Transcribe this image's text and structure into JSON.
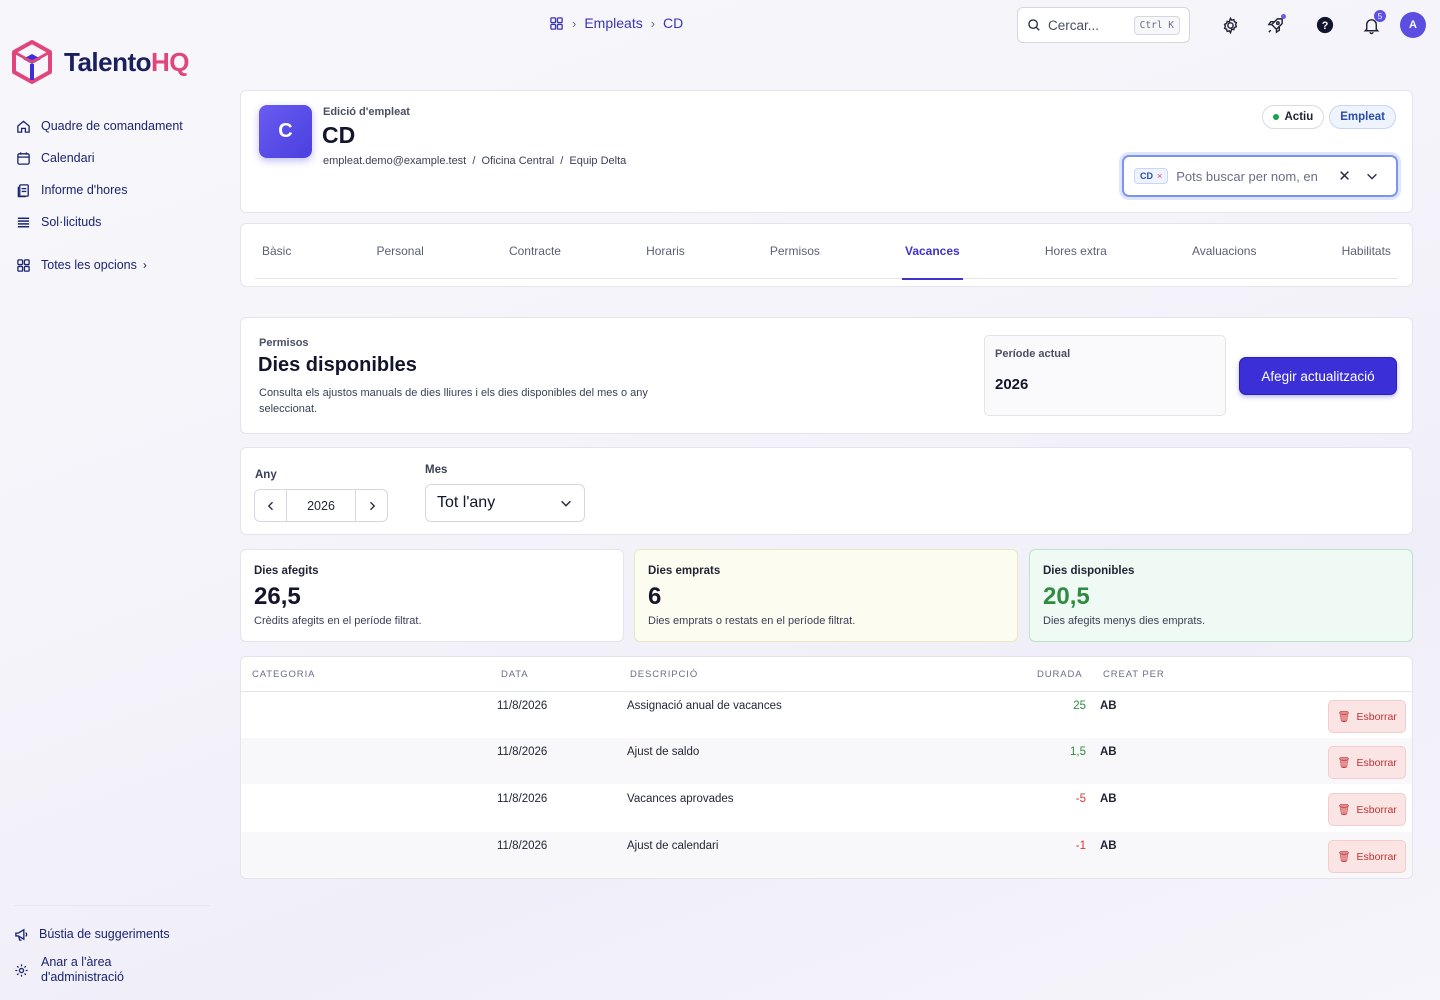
{
  "brand": {
    "name_main": "Talento",
    "name_accent": "HQ"
  },
  "sidebar": {
    "items": [
      {
        "label": "Quadre de comandament",
        "icon": "home-icon"
      },
      {
        "label": "Calendari",
        "icon": "calendar-icon"
      },
      {
        "label": "Informe d'hores",
        "icon": "report-icon"
      },
      {
        "label": "Sol·licituds",
        "icon": "list-icon"
      }
    ],
    "all_options": "Totes les opcions",
    "suggestions": "Bústia de suggeriments",
    "admin_line1": "Anar a l'àrea",
    "admin_line2": "d'administració"
  },
  "topbar": {
    "breadcrumb": [
      "Empleats",
      "CD"
    ],
    "search_placeholder": "Cercar...",
    "search_shortcut": "Ctrl K",
    "notifications_count": "5",
    "user_initial": "A"
  },
  "employee": {
    "subtitle": "Edició d'empleat",
    "initial": "C",
    "name": "CD",
    "email": "empleat.demo@example.test",
    "office": "Oficina Central",
    "team": "Equip Delta",
    "sep": "/",
    "status": "Actiu",
    "role": "Empleat",
    "selected_chip": "CD",
    "select_placeholder": "Pots buscar per nom, en"
  },
  "tabs": [
    "Bàsic",
    "Personal",
    "Contracte",
    "Horaris",
    "Permisos",
    "Vacances",
    "Hores extra",
    "Avaluacions",
    "Habilitats"
  ],
  "active_tab": "Vacances",
  "permissions": {
    "eyebrow": "Permisos",
    "title": "Dies disponibles",
    "description": "Consulta els ajustos manuals de dies lliures i els dies disponibles del mes o any seleccionat.",
    "period_label": "Període actual",
    "period_value": "2026",
    "add_button": "Afegir actualització"
  },
  "filters": {
    "year_label": "Any",
    "year_value": "2026",
    "month_label": "Mes",
    "month_value": "Tot l'any"
  },
  "stats": [
    {
      "label": "Dies afegits",
      "value": "26,5",
      "desc": "Crèdits afegits en el període filtrat."
    },
    {
      "label": "Dies emprats",
      "value": "6",
      "desc": "Dies emprats o restats en el període filtrat."
    },
    {
      "label": "Dies disponibles",
      "value": "20,5",
      "desc": "Dies afegits menys dies emprats."
    }
  ],
  "table": {
    "headers": [
      "CATEGORIA",
      "DATA",
      "DESCRIPCIÓ",
      "DURADA",
      "CREAT PER"
    ],
    "delete_label": "Esborrar",
    "rows": [
      {
        "category": "",
        "date": "11/8/2026",
        "description": "Assignació anual de vacances",
        "duration": "25",
        "created_by": "AB"
      },
      {
        "category": "",
        "date": "11/8/2026",
        "description": "Ajust de saldo",
        "duration": "1,5",
        "created_by": "AB"
      },
      {
        "category": "",
        "date": "11/8/2026",
        "description": "Vacances aprovades",
        "duration": "-5",
        "created_by": "AB"
      },
      {
        "category": "",
        "date": "11/8/2026",
        "description": "Ajust de calendari",
        "duration": "-1",
        "created_by": "AB"
      }
    ]
  },
  "colors": {
    "accent": "#3b2fd8",
    "brand_pink": "#e0457b",
    "positive": "#2e8b3f",
    "negative": "#d03a3a"
  }
}
